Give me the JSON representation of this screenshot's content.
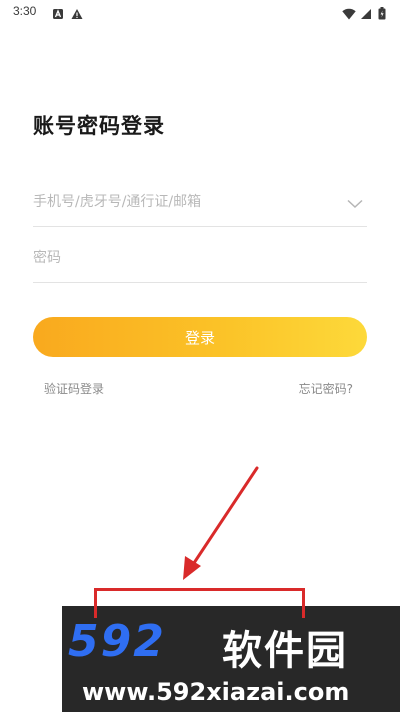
{
  "status_bar": {
    "time": "3:30",
    "left_icons": [
      "a-notification-icon",
      "warning-icon"
    ],
    "right_icons": [
      "wifi-icon",
      "signal-icon",
      "battery-icon"
    ]
  },
  "login": {
    "title": "账号密码登录",
    "account_placeholder": "手机号/虎牙号/通行证/邮箱",
    "password_placeholder": "密码",
    "submit_label": "登录",
    "sms_login_label": "验证码登录",
    "forgot_password_label": "忘记密码?"
  },
  "watermark": {
    "brand": "592",
    "brand_cn": "软件园",
    "url": "www.592xiazai.com"
  },
  "colors": {
    "accent_start": "#f9a91e",
    "accent_end": "#fdd93a",
    "annotation": "#d92a2a",
    "brand_blue": "#2f6ef2"
  }
}
